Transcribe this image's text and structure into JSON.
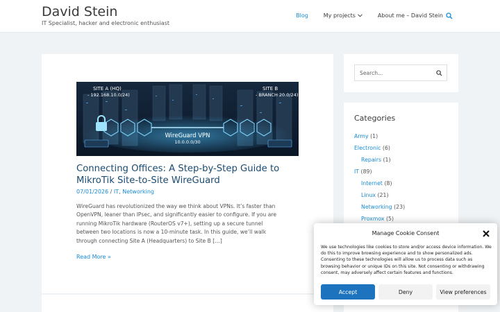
{
  "header": {
    "site_title": "David Stein",
    "site_description": "IT Specialist, hacker and electronic enthusiast",
    "nav": [
      {
        "label": "Blog"
      },
      {
        "label": "My projects"
      },
      {
        "label": "About me – David Stein"
      }
    ],
    "search_icon": "search-icon"
  },
  "post": {
    "hero": {
      "site_a": "SITE A (HQ)",
      "site_a_net": "- 192.168.10.0/24)",
      "site_b": "SITE B",
      "site_b_net": "- BRANCH 20.0/24)",
      "vpn_label": "WireGuard VPN",
      "vpn_net": "10.0.0.0/30"
    },
    "title": "Connecting Offices: A Step-by-Step Guide to MikroTik Site-to-Site WireGuard",
    "date": "07/01/2026",
    "sep": " / ",
    "cat1": "IT",
    "comma": ", ",
    "cat2": "Networking",
    "excerpt": "WireGuard has revolutionized the way we think about VPNs. It’s faster than OpenVPN, leaner than IPsec, and significantly easier to configure. If you are running MikroTik hardware (RouterOS v7+), setting up a secure tunnel between two locations is now a 10-minute task. In this guide, we’ll walk through connecting Site A (Headquarters) to Site B […]",
    "read_more": "Read More »"
  },
  "sidebar": {
    "search_placeholder": "Search...",
    "categories_title": "Categories",
    "categories": [
      {
        "name": "Army",
        "count": " (1)",
        "sub": false
      },
      {
        "name": "Electronic",
        "count": " (6)",
        "sub": false
      },
      {
        "name": "Repairs",
        "count": " (1)",
        "sub": true
      },
      {
        "name": "IT",
        "count": " (89)",
        "sub": false
      },
      {
        "name": "Internet",
        "count": " (8)",
        "sub": true
      },
      {
        "name": "Linux",
        "count": " (21)",
        "sub": true
      },
      {
        "name": "Networking",
        "count": " (23)",
        "sub": true
      },
      {
        "name": "Proxmox",
        "count": " (5)",
        "sub": true
      }
    ]
  },
  "cookie": {
    "title": "Manage Cookie Consent",
    "text": "We use technologies like cookies to store and/or access device information. We do this to improve browsing experience and to show personalized ads. Consenting to these technologies will allow us to process data such as browsing behavior or unique IDs on this site. Not consenting or withdrawing consent, may adversely affect certain features and functions.",
    "accept": "Accept",
    "deny": "Deny",
    "preferences": "View preferences"
  },
  "colors": {
    "accent": "#1a8ad4",
    "title": "#1a4b70",
    "accept_button": "#1e73be"
  }
}
